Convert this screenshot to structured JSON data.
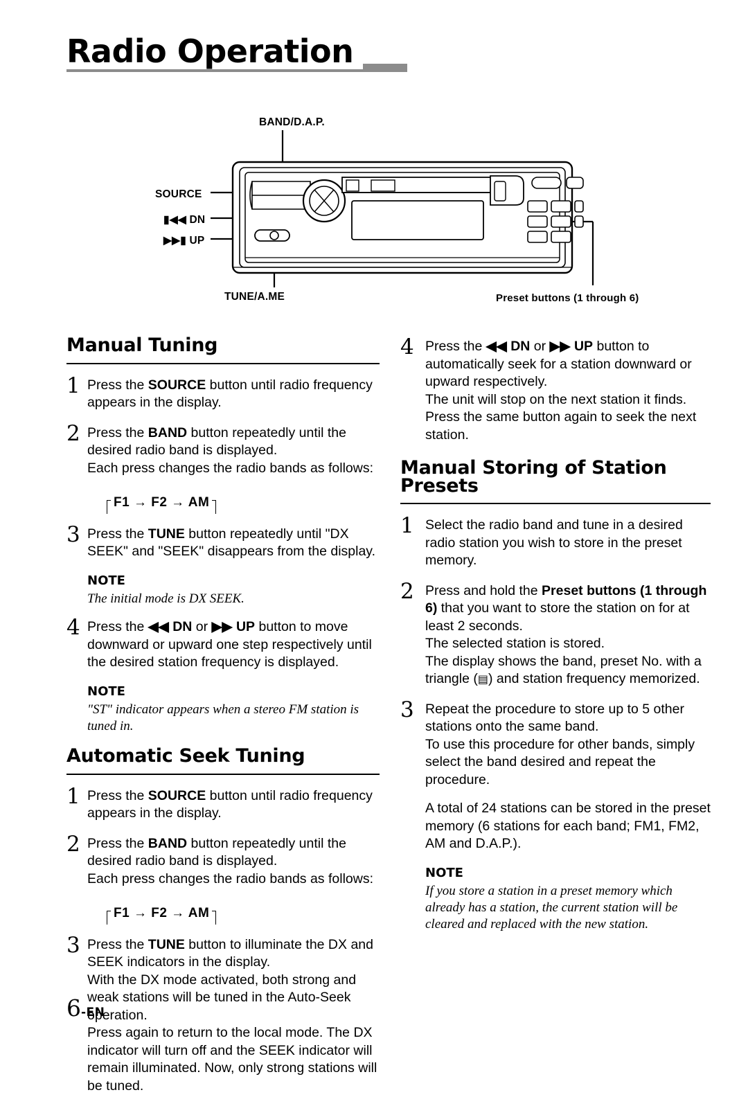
{
  "page": {
    "title": "Radio Operation",
    "footer_page": "6",
    "footer_lang": "-EN"
  },
  "diagram": {
    "labels": {
      "band": "BAND/D.A.P.",
      "source": "SOURCE",
      "dn": "DN",
      "up": "UP",
      "tune": "TUNE/A.ME",
      "preset": "Preset buttons (1 through 6)"
    }
  },
  "left_column": {
    "section1": {
      "heading": "Manual Tuning",
      "steps": [
        {
          "num": "1",
          "html": "Press the <b>SOURCE</b> button until radio frequency appears in the display."
        },
        {
          "num": "2",
          "html": "Press the <b>BAND</b> button repeatedly until the desired radio band is displayed.<br>Each press changes the radio bands as follows:"
        },
        {
          "num": "3",
          "html": "Press the <b>TUNE</b> button repeatedly until \"DX SEEK\" and \"SEEK\" disappears from the display."
        },
        {
          "num": "4",
          "html": "Press the <b>&#9664;&#9664; DN</b> or <b>&#9654;&#9654; UP</b> button to move downward or upward one step respectively until the desired station frequency is displayed."
        }
      ],
      "band_sequence": "F1 → F2 → AM",
      "note1_head": "NOTE",
      "note1_body": "The initial mode is DX SEEK.",
      "note2_head": "NOTE",
      "note2_body": "\"ST\" indicator appears when a stereo FM station is tuned in."
    },
    "section2": {
      "heading": "Automatic Seek Tuning",
      "steps": [
        {
          "num": "1",
          "html": "Press the <b>SOURCE</b> button until radio frequency appears in the display."
        },
        {
          "num": "2",
          "html": "Press the <b>BAND</b> button repeatedly until the desired radio band is displayed.<br>Each press changes the radio bands as follows:"
        },
        {
          "num": "3",
          "html": "Press the <b>TUNE</b> button to illuminate the DX and SEEK indicators in the display.<br>With the DX mode activated, both strong and weak stations will be tuned in the Auto-Seek operation.<br>Press again to return to the local mode. The DX indicator will turn off and the SEEK indicator will remain illuminated. Now, only strong stations will be tuned."
        }
      ],
      "band_sequence": "F1 → F2 → AM"
    }
  },
  "right_column": {
    "step4": {
      "num": "4",
      "html": "Press the <b>&#9664;&#9664; DN</b> or <b>&#9654;&#9654; UP</b> button to automatically seek for a station downward or upward respectively.<br>The unit will stop on the next station it finds. Press the same button again to seek the next station."
    },
    "section3": {
      "heading": "Manual Storing of Station Presets",
      "steps": [
        {
          "num": "1",
          "html": "Select the radio band and tune in a desired radio station you wish to store in the preset memory."
        },
        {
          "num": "2",
          "html": "Press and hold the <b>Preset buttons (1 through 6)</b> that you want to store the station on for at least 2 seconds.<br>The selected station is stored.<br>The display shows the band, preset No. with a triangle (<span class=\"tri\">&#9636;</span>) and station frequency memorized."
        },
        {
          "num": "3",
          "html": "Repeat the procedure to store up to 5 other stations onto the same band.<br>To use this procedure for other bands, simply select the band desired and repeat the procedure."
        }
      ],
      "total_paragraph": "A total of 24 stations can be stored in the preset memory (6 stations for each band; FM1, FM2, AM and D.A.P.).",
      "note_head": "NOTE",
      "note_body": "If you store a station in a preset memory which already has a station, the current station will be cleared and replaced with the new station."
    }
  }
}
